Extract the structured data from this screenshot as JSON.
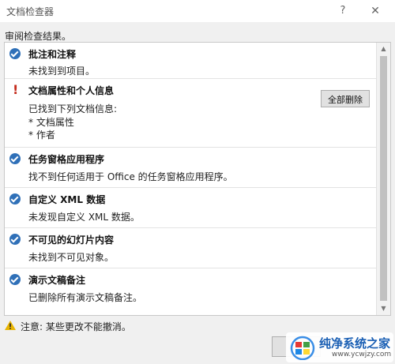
{
  "window": {
    "title": "文档检查器",
    "help_label": "?",
    "close_label": "✕"
  },
  "subtitle": "审阅检查结果。",
  "sections": [
    {
      "status": "ok",
      "title": "批注和注释",
      "lines": [
        "未找到到项目。"
      ]
    },
    {
      "status": "warning",
      "title": "文档属性和个人信息",
      "lines": [
        "已找到下列文档信息:",
        "* 文档属性",
        "* 作者"
      ],
      "action_label": "全部删除"
    },
    {
      "status": "ok",
      "title": "任务窗格应用程序",
      "lines": [
        "找不到任何适用于 Office 的任务窗格应用程序。"
      ]
    },
    {
      "status": "ok",
      "title": "自定义 XML 数据",
      "lines": [
        "未发现自定义 XML 数据。"
      ]
    },
    {
      "status": "ok",
      "title": "不可见的幻灯片内容",
      "lines": [
        "未找到不可见对象。"
      ]
    },
    {
      "status": "ok",
      "title": "演示文稿备注",
      "lines": [
        "已删除所有演示文稿备注。"
      ]
    }
  ],
  "footer": {
    "note": "注意: 某些更改不能撤消。"
  },
  "watermark": {
    "title": "纯净系统之家",
    "url": "www.ycwjzy.com"
  },
  "colors": {
    "check_blue": "#2f70b8",
    "warning_red": "#c42b1c",
    "caution_yellow": "#e8b400"
  }
}
